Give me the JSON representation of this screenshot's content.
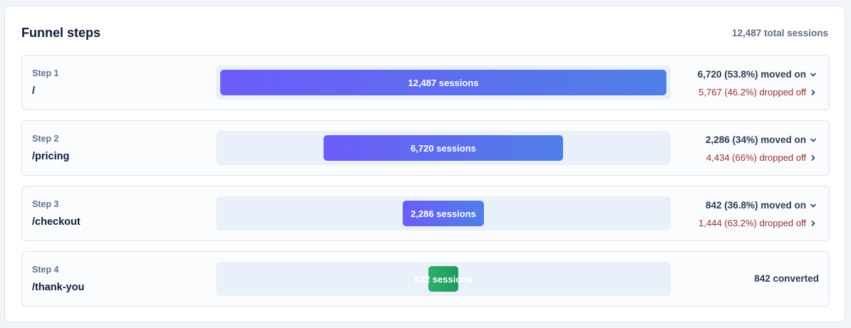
{
  "header": {
    "title": "Funnel steps",
    "total": "12,487 total sessions"
  },
  "steps": [
    {
      "label": "Step 1",
      "path": "/",
      "sessions": "12,487 sessions",
      "fraction": 1.0,
      "moved_on": "6,720 (53.8%) moved on",
      "dropped_off": "5,767 (46.2%) dropped off"
    },
    {
      "label": "Step 2",
      "path": "/pricing",
      "sessions": "6,720 sessions",
      "fraction": 0.538,
      "moved_on": "2,286 (34%) moved on",
      "dropped_off": "4,434 (66%) dropped off"
    },
    {
      "label": "Step 3",
      "path": "/checkout",
      "sessions": "2,286 sessions",
      "fraction": 0.183,
      "moved_on": "842 (36.8%) moved on",
      "dropped_off": "1,444 (63.2%) dropped off"
    },
    {
      "label": "Step 4",
      "path": "/thank-you",
      "sessions": "842 sessions",
      "fraction": 0.0674,
      "converted": "842 converted"
    }
  ],
  "colors": {
    "bar_start": "#6c5cf8",
    "bar_end": "#4f7fe6",
    "final_bar": "#2fae6d",
    "dropped": "#9b2c34"
  },
  "icons": {
    "moved_on": "chevron-down-icon",
    "dropped_off": "chevron-right-icon"
  }
}
